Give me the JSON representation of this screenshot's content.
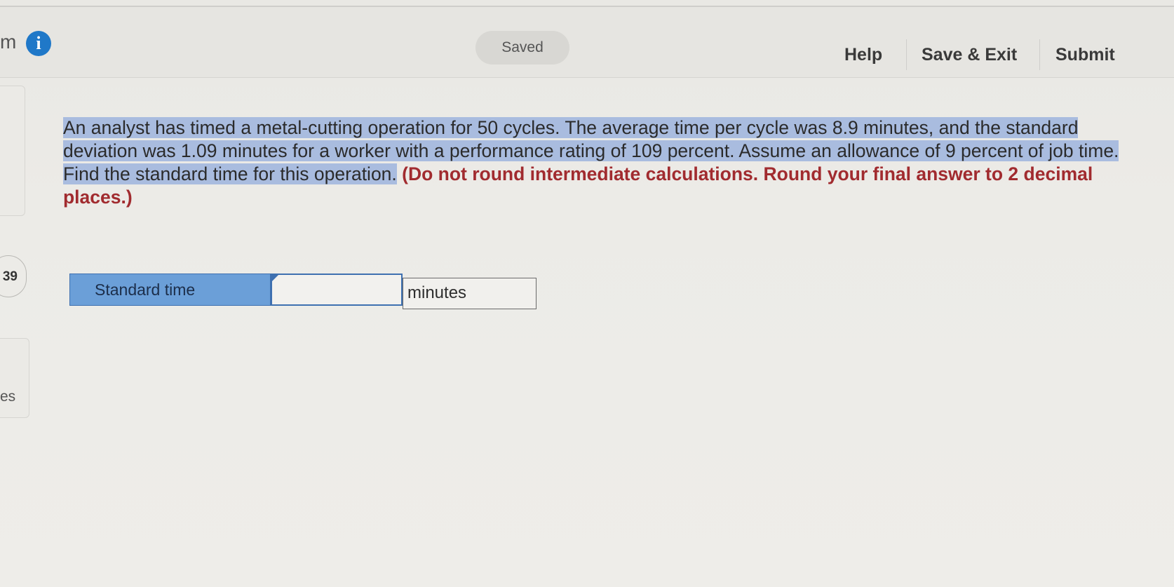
{
  "header": {
    "left_fragment": "m",
    "saved_status": "Saved",
    "help_label": "Help",
    "save_exit_label": "Save & Exit",
    "submit_label": "Submit"
  },
  "sidebar": {
    "question_number": "39",
    "bottom_fragment": "es"
  },
  "question": {
    "text": "An analyst has timed a metal-cutting operation for 50 cycles. The average time per cycle was 8.9 minutes, and the standard deviation was 1.09 minutes for a worker with a performance rating of 109 percent. Assume an allowance of 9 percent of job time. Find the standard time for this operation.",
    "instruction": "(Do not round intermediate calculations. Round your final answer to 2 decimal places.)"
  },
  "answer": {
    "label": "Standard time",
    "value": "",
    "unit": "minutes"
  }
}
